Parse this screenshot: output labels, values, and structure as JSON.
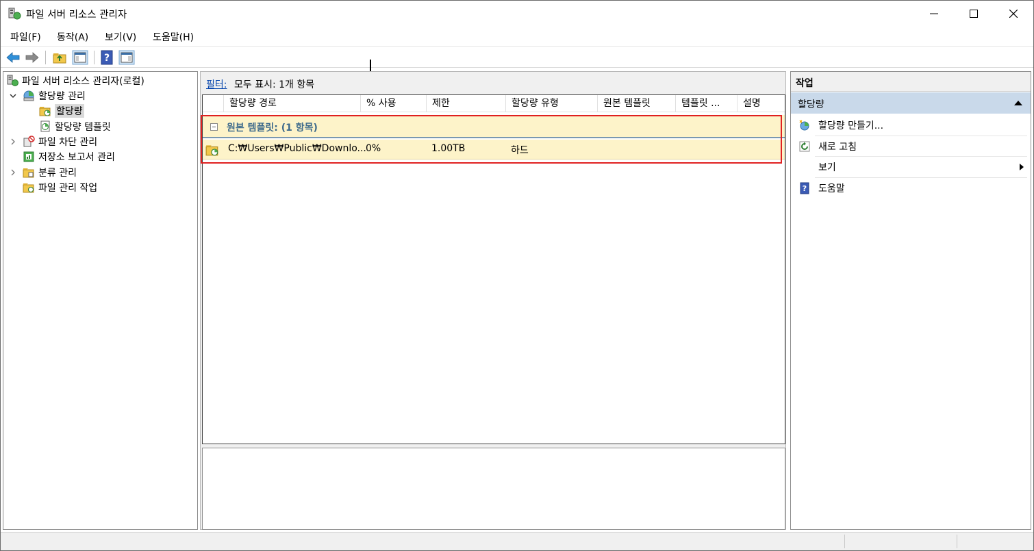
{
  "window": {
    "title": "파일 서버 리소스 관리자"
  },
  "menu": [
    "파일(F)",
    "동작(A)",
    "보기(V)",
    "도움말(H)"
  ],
  "tree": {
    "root": "파일 서버 리소스 관리자(로컬)",
    "quota_management": "할당량 관리",
    "quotas": "할당량",
    "quota_templates": "할당량 템플릿",
    "file_screening": "파일 차단 관리",
    "storage_reports": "저장소 보고서 관리",
    "classification": "분류 관리",
    "file_management_tasks": "파일 관리 작업"
  },
  "filter": {
    "link": "필터:",
    "text": "모두 표시: 1개 항목"
  },
  "columns": [
    "할당량 경로",
    "% 사용",
    "제한",
    "할당량 유형",
    "원본 템플릿",
    "템플릿 ...",
    "설명"
  ],
  "group": {
    "label": "원본 템플릿: (1 항목)"
  },
  "rows": [
    {
      "path": "C:₩Users₩Public₩Downlo...",
      "percent_used": "0%",
      "limit": "1.00TB",
      "quota_type": "하드"
    }
  ],
  "actions": {
    "header": "작업",
    "section": "할당량",
    "items": [
      "할당량 만들기...",
      "새로 고침",
      "보기",
      "도움말"
    ]
  },
  "colors": {
    "group_bg": "#fdf3c9",
    "section_bg": "#c9d9ea",
    "highlight": "#e02020",
    "link": "#0645ad"
  }
}
